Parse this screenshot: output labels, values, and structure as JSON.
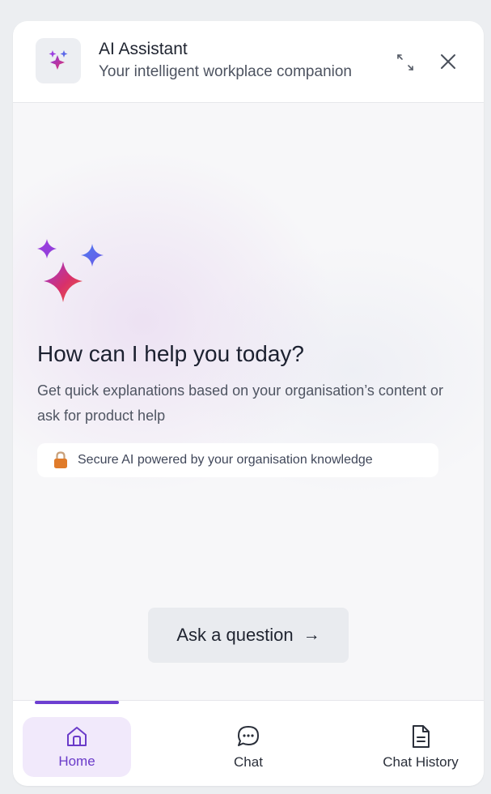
{
  "header": {
    "title": "AI Assistant",
    "subtitle": "Your intelligent workplace companion",
    "icons": {
      "logo": "sparkles-icon",
      "expand": "expand-icon",
      "close": "close-icon"
    }
  },
  "main": {
    "heading": "How can I help you today?",
    "description": "Get quick explanations based on your organisation’s content or ask for product help",
    "secure_badge": {
      "icon": "lock-icon",
      "text": "Secure AI powered by your organisation knowledge"
    },
    "ask_button": {
      "label": "Ask a question",
      "arrow": "→"
    }
  },
  "nav": {
    "items": [
      {
        "label": "Home",
        "icon": "home-icon",
        "active": true
      },
      {
        "label": "Chat",
        "icon": "chat-bubble-icon",
        "active": false
      },
      {
        "label": "Chat History",
        "icon": "document-icon",
        "active": false
      }
    ]
  },
  "colors": {
    "accent": "#6d3fd1",
    "active_nav_bg": "#f1e9fb",
    "lock": "#e07b2a"
  }
}
